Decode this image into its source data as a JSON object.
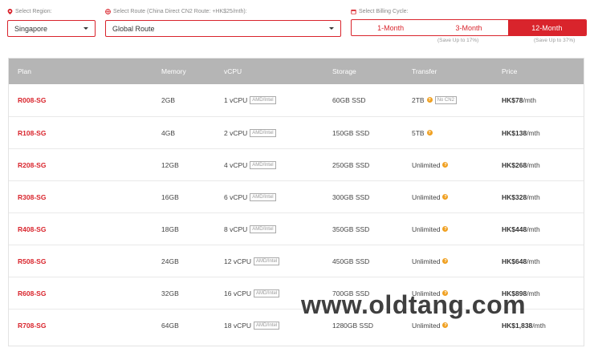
{
  "filters": {
    "region_label": "Select Region:",
    "region_value": "Singapore",
    "route_label": "Select Route (China Direct CN2 Route: +HK$25/mth):",
    "route_value": "Global Route",
    "billing_label": "Select Billing Cycle:",
    "billing_options": [
      {
        "label": "1-Month",
        "save": ""
      },
      {
        "label": "3-Month",
        "save": "(Save Up to 17%)"
      },
      {
        "label": "12-Month",
        "save": "(Save Up to 37%)"
      }
    ],
    "billing_selected": "12-Month"
  },
  "table": {
    "headers": [
      "Plan",
      "Memory",
      "vCPU",
      "Storage",
      "Transfer",
      "Price"
    ],
    "cpu_tag": "AMD/Intel",
    "no_cn2_tag": "No CN2",
    "rows": [
      {
        "plan": "R008-SG",
        "memory": "2GB",
        "vcpu": "1 vCPU",
        "storage": "60GB SSD",
        "transfer": "2TB",
        "no_cn2": true,
        "price": "HK$78",
        "unit": "/mth"
      },
      {
        "plan": "R108-SG",
        "memory": "4GB",
        "vcpu": "2 vCPU",
        "storage": "150GB SSD",
        "transfer": "5TB",
        "no_cn2": false,
        "price": "HK$138",
        "unit": "/mth"
      },
      {
        "plan": "R208-SG",
        "memory": "12GB",
        "vcpu": "4 vCPU",
        "storage": "250GB SSD",
        "transfer": "Unlimited",
        "no_cn2": false,
        "price": "HK$268",
        "unit": "/mth"
      },
      {
        "plan": "R308-SG",
        "memory": "16GB",
        "vcpu": "6 vCPU",
        "storage": "300GB SSD",
        "transfer": "Unlimited",
        "no_cn2": false,
        "price": "HK$328",
        "unit": "/mth"
      },
      {
        "plan": "R408-SG",
        "memory": "18GB",
        "vcpu": "8 vCPU",
        "storage": "350GB SSD",
        "transfer": "Unlimited",
        "no_cn2": false,
        "price": "HK$448",
        "unit": "/mth"
      },
      {
        "plan": "R508-SG",
        "memory": "24GB",
        "vcpu": "12 vCPU",
        "storage": "450GB SSD",
        "transfer": "Unlimited",
        "no_cn2": false,
        "price": "HK$648",
        "unit": "/mth"
      },
      {
        "plan": "R608-SG",
        "memory": "32GB",
        "vcpu": "16 vCPU",
        "storage": "700GB SSD",
        "transfer": "Unlimited",
        "no_cn2": false,
        "price": "HK$898",
        "unit": "/mth"
      },
      {
        "plan": "R708-SG",
        "memory": "64GB",
        "vcpu": "18 vCPU",
        "storage": "1280GB SSD",
        "transfer": "Unlimited",
        "no_cn2": false,
        "price": "HK$1,838",
        "unit": "/mth"
      }
    ]
  },
  "watermark": "www.oldtang.com",
  "colors": {
    "accent": "#d9242c",
    "header_bg": "#b5b5b5",
    "help_icon": "#f0a020"
  }
}
